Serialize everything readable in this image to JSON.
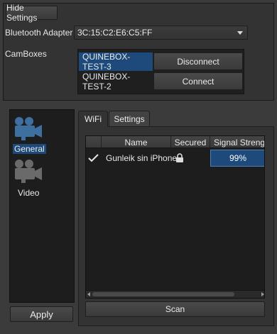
{
  "settings": {
    "hide_settings_label": "Hide Settings",
    "bluetooth_adapter_label": "Bluetooth Adapter",
    "bluetooth_adapter_value": "3C:15:C2:E6:C5:FF",
    "camboxes_label": "CamBoxes",
    "camboxes": [
      {
        "name": "QUINEBOX-TEST-3",
        "action": "Disconnect",
        "selected": true
      },
      {
        "name": "QUINEBOX-TEST-2",
        "action": "Connect",
        "selected": false
      }
    ]
  },
  "nav": {
    "items": [
      {
        "label": "General",
        "icon": "camera-icon",
        "selected": true
      },
      {
        "label": "Video",
        "icon": "camera-icon",
        "selected": false
      }
    ],
    "apply_label": "Apply"
  },
  "tabs": [
    {
      "label": "WiFi",
      "active": true
    },
    {
      "label": "Settings",
      "active": false
    }
  ],
  "wifi": {
    "columns": [
      "",
      "Name",
      "Secured",
      "Signal Strengt"
    ],
    "rows": [
      {
        "checked": true,
        "name": "Gunleik sin iPhone",
        "secured": true,
        "signal": "99%"
      }
    ],
    "scan_label": "Scan"
  },
  "colors": {
    "selection": "#1d4a7a",
    "background": "#3b3b3b",
    "panel": "#333333"
  }
}
